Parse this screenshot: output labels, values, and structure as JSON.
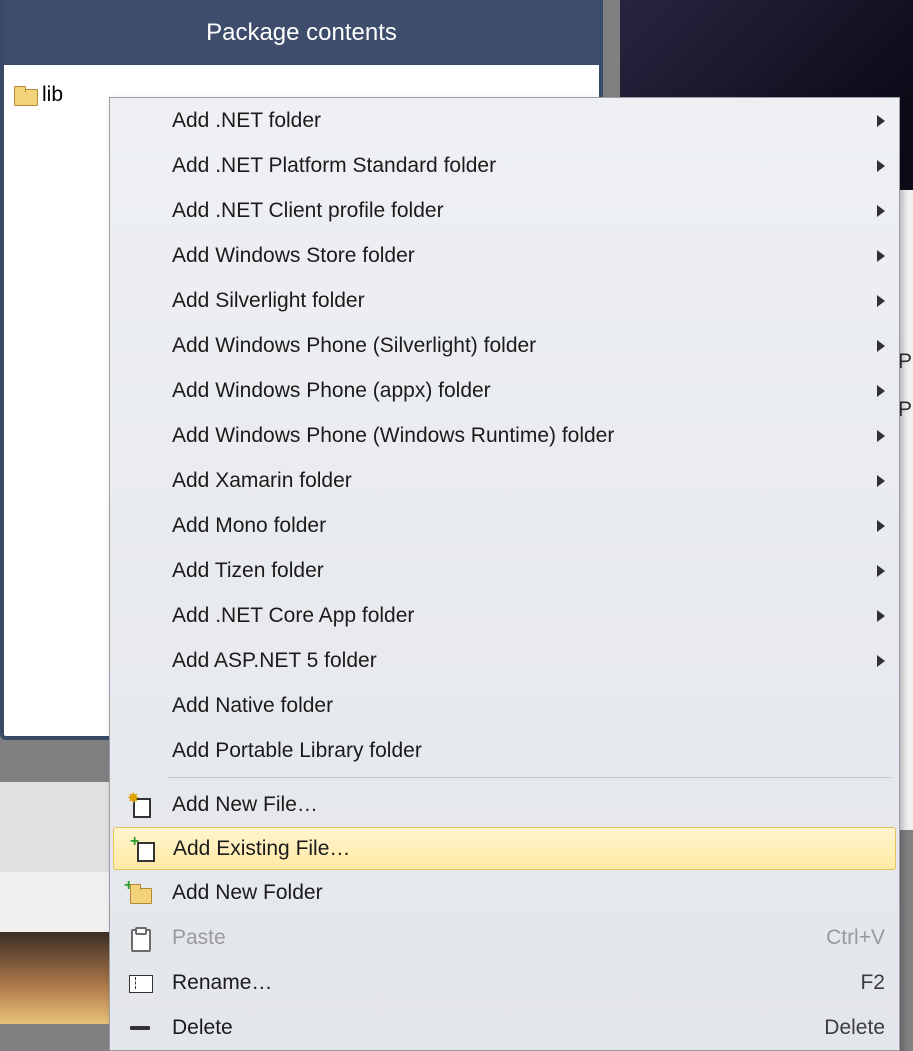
{
  "panel": {
    "title": "Package contents",
    "tree": {
      "root_label": "lib"
    }
  },
  "right_hints": {
    "p1": "P",
    "p2": "P"
  },
  "menu": {
    "items": [
      {
        "label": "Add .NET folder",
        "submenu": true,
        "icon": null,
        "name": "add-net-folder"
      },
      {
        "label": "Add .NET Platform Standard folder",
        "submenu": true,
        "icon": null,
        "name": "add-net-platform-standard-folder"
      },
      {
        "label": "Add .NET Client profile folder",
        "submenu": true,
        "icon": null,
        "name": "add-net-client-profile-folder"
      },
      {
        "label": "Add Windows Store folder",
        "submenu": true,
        "icon": null,
        "name": "add-windows-store-folder"
      },
      {
        "label": "Add Silverlight folder",
        "submenu": true,
        "icon": null,
        "name": "add-silverlight-folder"
      },
      {
        "label": "Add Windows Phone (Silverlight) folder",
        "submenu": true,
        "icon": null,
        "name": "add-windows-phone-silverlight-folder"
      },
      {
        "label": "Add Windows Phone (appx) folder",
        "submenu": true,
        "icon": null,
        "name": "add-windows-phone-appx-folder"
      },
      {
        "label": "Add Windows Phone (Windows Runtime) folder",
        "submenu": true,
        "icon": null,
        "name": "add-windows-phone-winrt-folder"
      },
      {
        "label": "Add Xamarin folder",
        "submenu": true,
        "icon": null,
        "name": "add-xamarin-folder"
      },
      {
        "label": "Add Mono folder",
        "submenu": true,
        "icon": null,
        "name": "add-mono-folder"
      },
      {
        "label": "Add Tizen folder",
        "submenu": true,
        "icon": null,
        "name": "add-tizen-folder"
      },
      {
        "label": "Add .NET Core App folder",
        "submenu": true,
        "icon": null,
        "name": "add-net-core-app-folder"
      },
      {
        "label": "Add ASP.NET 5 folder",
        "submenu": true,
        "icon": null,
        "name": "add-aspnet5-folder"
      },
      {
        "label": "Add Native folder",
        "submenu": false,
        "icon": null,
        "name": "add-native-folder"
      },
      {
        "label": "Add Portable Library folder",
        "submenu": false,
        "icon": null,
        "name": "add-portable-library-folder"
      },
      {
        "separator": true
      },
      {
        "label": "Add New File…",
        "submenu": false,
        "icon": "new-file",
        "name": "add-new-file"
      },
      {
        "label": "Add Existing File…",
        "submenu": false,
        "icon": "add-file",
        "name": "add-existing-file",
        "highlight": true
      },
      {
        "label": "Add New Folder",
        "submenu": false,
        "icon": "add-folder",
        "name": "add-new-folder"
      },
      {
        "label": "Paste",
        "shortcut": "Ctrl+V",
        "submenu": false,
        "icon": "paste",
        "name": "paste",
        "disabled": true
      },
      {
        "label": "Rename…",
        "shortcut": "F2",
        "submenu": false,
        "icon": "rename",
        "name": "rename"
      },
      {
        "label": "Delete",
        "shortcut": "Delete",
        "submenu": false,
        "icon": "delete",
        "name": "delete"
      }
    ]
  }
}
